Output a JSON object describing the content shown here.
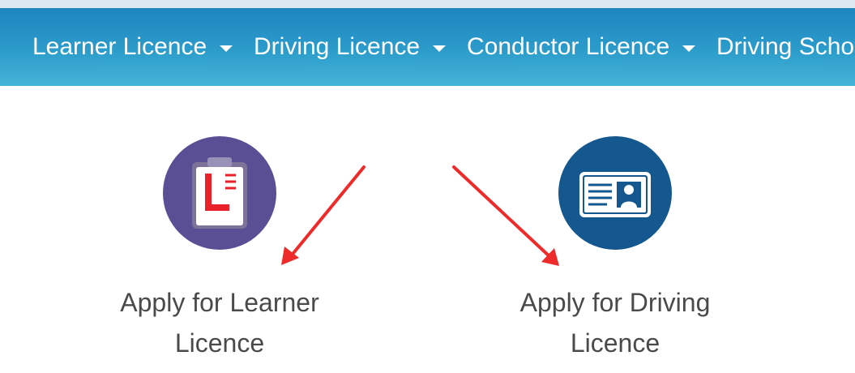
{
  "nav": {
    "items": [
      {
        "label": "Learner Licence"
      },
      {
        "label": "Driving Licence"
      },
      {
        "label": "Conductor Licence"
      },
      {
        "label": "Driving School"
      }
    ]
  },
  "cards": [
    {
      "line1": "Apply for Learner",
      "line2": "Licence",
      "icon": "learner-clipboard-icon",
      "color": "#5a4f95"
    },
    {
      "line1": "Apply for Driving",
      "line2": "Licence",
      "icon": "id-card-icon",
      "color": "#15578f"
    }
  ],
  "colors": {
    "nav_top": "#1f84bf",
    "nav_bottom": "#45b4d8",
    "annotation_arrow": "#ee2b2b",
    "text": "#4a4a4a"
  }
}
